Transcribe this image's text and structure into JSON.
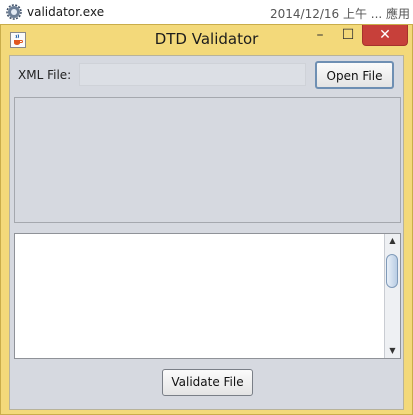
{
  "explorer": {
    "file_name": "validator.exe",
    "modified_date": "2014/12/16 上午 ...",
    "file_type": "應用"
  },
  "window": {
    "title": "DTD Validator",
    "controls": {
      "minimize": "–",
      "maximize": "☐",
      "close": "✕"
    }
  },
  "form": {
    "xml_file_label": "XML File:",
    "xml_file_value": "",
    "open_button": "Open File",
    "output_text": "",
    "validate_button": "Validate File"
  },
  "icons": {
    "explorer_file": "gear-app-icon",
    "window_app": "java-cup-icon",
    "scroll_up": "scroll-up-arrow-icon",
    "scroll_down": "scroll-down-arrow-icon"
  },
  "colors": {
    "window_frame": "#f3d97a",
    "client_background": "#d6d9e0",
    "close_button": "#c7403a",
    "button_focus_border": "#6e8fb3"
  }
}
